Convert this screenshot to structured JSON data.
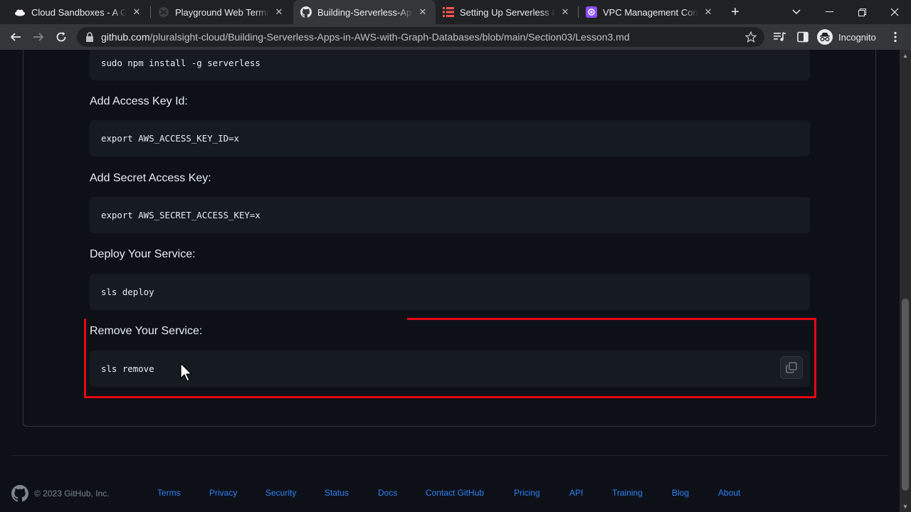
{
  "tabs": [
    {
      "title": "Cloud Sandboxes - A Cloud Guru",
      "icon": "cloud-icon",
      "active": false
    },
    {
      "title": "Playground Web Terminal",
      "icon": "terminal-icon",
      "active": false
    },
    {
      "title": "Building-Serverless-Apps-in-AWS",
      "icon": "github-icon",
      "active": true
    },
    {
      "title": "Setting Up Serverless Framework",
      "icon": "serverless-icon",
      "active": false
    },
    {
      "title": "VPC Management Console",
      "icon": "vpc-icon",
      "active": false
    }
  ],
  "address_bar": {
    "host": "github.com",
    "path": "/pluralsight-cloud/Building-Serverless-Apps-in-AWS-with-Graph-Databases/blob/main/Section03/Lesson3.md"
  },
  "profile": {
    "label": "Incognito"
  },
  "content": {
    "first_code": "sudo npm install -g serverless",
    "sections": [
      {
        "heading": "Add Access Key Id:",
        "code": "export AWS_ACCESS_KEY_ID=x"
      },
      {
        "heading": "Add Secret Access Key:",
        "code": "export AWS_SECRET_ACCESS_KEY=x"
      },
      {
        "heading": "Deploy Your Service:",
        "code": "sls deploy"
      },
      {
        "heading": "Remove Your Service:",
        "code": "sls remove"
      }
    ]
  },
  "footer": {
    "copyright": "© 2023 GitHub, Inc.",
    "links": [
      "Terms",
      "Privacy",
      "Security",
      "Status",
      "Docs",
      "Contact GitHub",
      "Pricing",
      "API",
      "Training",
      "Blog",
      "About"
    ]
  },
  "colors": {
    "highlight": "#e50914",
    "link": "#2f81f7",
    "page_bg": "#0d1117",
    "code_bg": "#161b22"
  }
}
